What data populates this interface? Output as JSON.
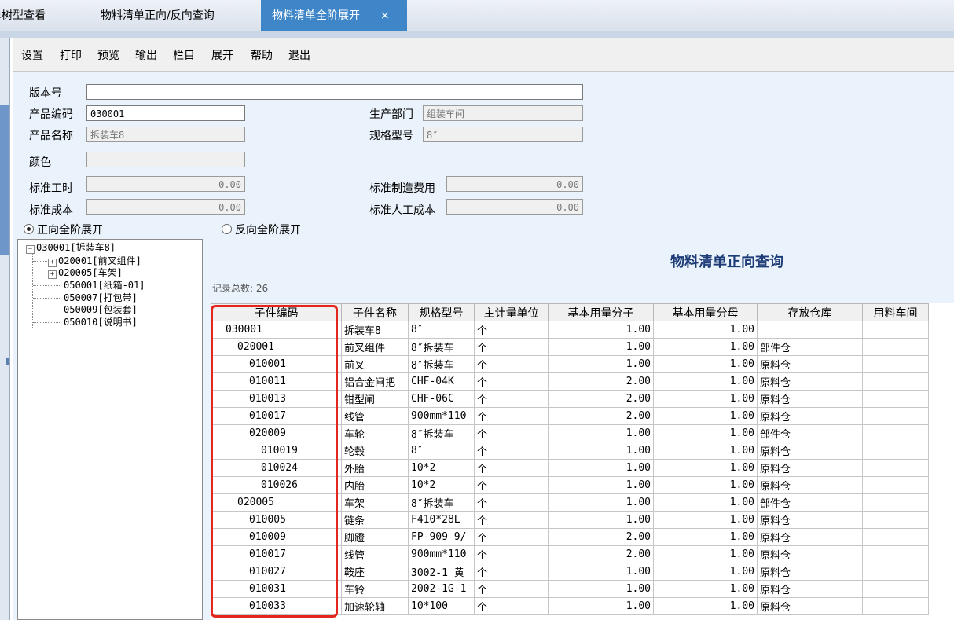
{
  "tabs": [
    {
      "label": "单树型查看"
    },
    {
      "label": "物料清单正向/反向查询"
    },
    {
      "label": "物料清单全阶展开",
      "close": "×"
    }
  ],
  "toolbar": [
    "设置",
    "打印",
    "预览",
    "输出",
    "栏目",
    "展开",
    "帮助",
    "退出"
  ],
  "form": {
    "version_label": "版本号",
    "version_value": "",
    "product_code_label": "产品编码",
    "product_code_value": "030001",
    "department_label": "生产部门",
    "department_value": "组装车间",
    "product_name_label": "产品名称",
    "product_name_value": "拆装车8",
    "spec_label": "规格型号",
    "spec_value": "8″",
    "color_label": "颜色",
    "color_value": "",
    "std_hours_label": "标准工时",
    "std_hours_value": "0.00",
    "std_mfg_cost_label": "标准制造费用",
    "std_mfg_cost_value": "0.00",
    "std_cost_label": "标准成本",
    "std_cost_value": "0.00",
    "std_labor_cost_label": "标准人工成本",
    "std_labor_cost_value": "0.00"
  },
  "radios": {
    "forward": "正向全阶展开",
    "reverse": "反向全阶展开",
    "selected": "forward"
  },
  "tree": {
    "root": "030001[拆装车8]",
    "children": [
      {
        "label": "020001[前叉组件]",
        "expandable": true
      },
      {
        "label": "020005[车架]",
        "expandable": true
      },
      {
        "label": "050001[纸箱-01]",
        "expandable": false
      },
      {
        "label": "050007[打包带]",
        "expandable": false
      },
      {
        "label": "050009[包装套]",
        "expandable": false
      },
      {
        "label": "050010[说明书]",
        "expandable": false
      }
    ]
  },
  "report": {
    "title": "物料清单正向查询",
    "record_count": "记录总数: 26",
    "columns": [
      "子件编码",
      "子件名称",
      "规格型号",
      "主计量单位",
      "基本用量分子",
      "基本用量分母",
      "存放仓库",
      "用料车间"
    ],
    "rows": [
      {
        "level": 0,
        "code": "030001",
        "name": "拆装车8",
        "spec": "8″",
        "unit": "个",
        "num": "1.00",
        "den": "1.00",
        "wh": "",
        "ws": ""
      },
      {
        "level": 1,
        "code": "020001",
        "name": "前叉组件",
        "spec": "8″拆装车",
        "unit": "个",
        "num": "1.00",
        "den": "1.00",
        "wh": "部件仓",
        "ws": ""
      },
      {
        "level": 2,
        "code": "010001",
        "name": "前叉",
        "spec": "8″拆装车",
        "unit": "个",
        "num": "1.00",
        "den": "1.00",
        "wh": "原料仓",
        "ws": ""
      },
      {
        "level": 2,
        "code": "010011",
        "name": "铝合金闸把",
        "spec": "CHF-04K",
        "unit": "个",
        "num": "2.00",
        "den": "1.00",
        "wh": "原料仓",
        "ws": ""
      },
      {
        "level": 2,
        "code": "010013",
        "name": "钳型闸",
        "spec": "CHF-06C",
        "unit": "个",
        "num": "2.00",
        "den": "1.00",
        "wh": "原料仓",
        "ws": ""
      },
      {
        "level": 2,
        "code": "010017",
        "name": "线管",
        "spec": "900mm*110",
        "unit": "个",
        "num": "2.00",
        "den": "1.00",
        "wh": "原料仓",
        "ws": ""
      },
      {
        "level": 2,
        "code": "020009",
        "name": "车轮",
        "spec": "8″拆装车",
        "unit": "个",
        "num": "1.00",
        "den": "1.00",
        "wh": "部件仓",
        "ws": ""
      },
      {
        "level": 3,
        "code": "010019",
        "name": "轮毂",
        "spec": "8″",
        "unit": "个",
        "num": "1.00",
        "den": "1.00",
        "wh": "原料仓",
        "ws": ""
      },
      {
        "level": 3,
        "code": "010024",
        "name": "外胎",
        "spec": "10*2",
        "unit": "个",
        "num": "1.00",
        "den": "1.00",
        "wh": "原料仓",
        "ws": ""
      },
      {
        "level": 3,
        "code": "010026",
        "name": "内胎",
        "spec": "10*2",
        "unit": "个",
        "num": "1.00",
        "den": "1.00",
        "wh": "原料仓",
        "ws": ""
      },
      {
        "level": 1,
        "code": "020005",
        "name": "车架",
        "spec": "8″拆装车",
        "unit": "个",
        "num": "1.00",
        "den": "1.00",
        "wh": "部件仓",
        "ws": ""
      },
      {
        "level": 2,
        "code": "010005",
        "name": "链条",
        "spec": "F410*28L",
        "unit": "个",
        "num": "1.00",
        "den": "1.00",
        "wh": "原料仓",
        "ws": ""
      },
      {
        "level": 2,
        "code": "010009",
        "name": "脚蹬",
        "spec": "FP-909 9/",
        "unit": "个",
        "num": "2.00",
        "den": "1.00",
        "wh": "原料仓",
        "ws": ""
      },
      {
        "level": 2,
        "code": "010017",
        "name": "线管",
        "spec": "900mm*110",
        "unit": "个",
        "num": "2.00",
        "den": "1.00",
        "wh": "原料仓",
        "ws": ""
      },
      {
        "level": 2,
        "code": "010027",
        "name": "鞍座",
        "spec": "3002-1 黄",
        "unit": "个",
        "num": "1.00",
        "den": "1.00",
        "wh": "原料仓",
        "ws": ""
      },
      {
        "level": 2,
        "code": "010031",
        "name": "车铃",
        "spec": "2002-1G-1",
        "unit": "个",
        "num": "1.00",
        "den": "1.00",
        "wh": "原料仓",
        "ws": ""
      },
      {
        "level": 2,
        "code": "010033",
        "name": "加速轮轴",
        "spec": "10*100",
        "unit": "个",
        "num": "1.00",
        "den": "1.00",
        "wh": "原料仓",
        "ws": ""
      }
    ]
  }
}
